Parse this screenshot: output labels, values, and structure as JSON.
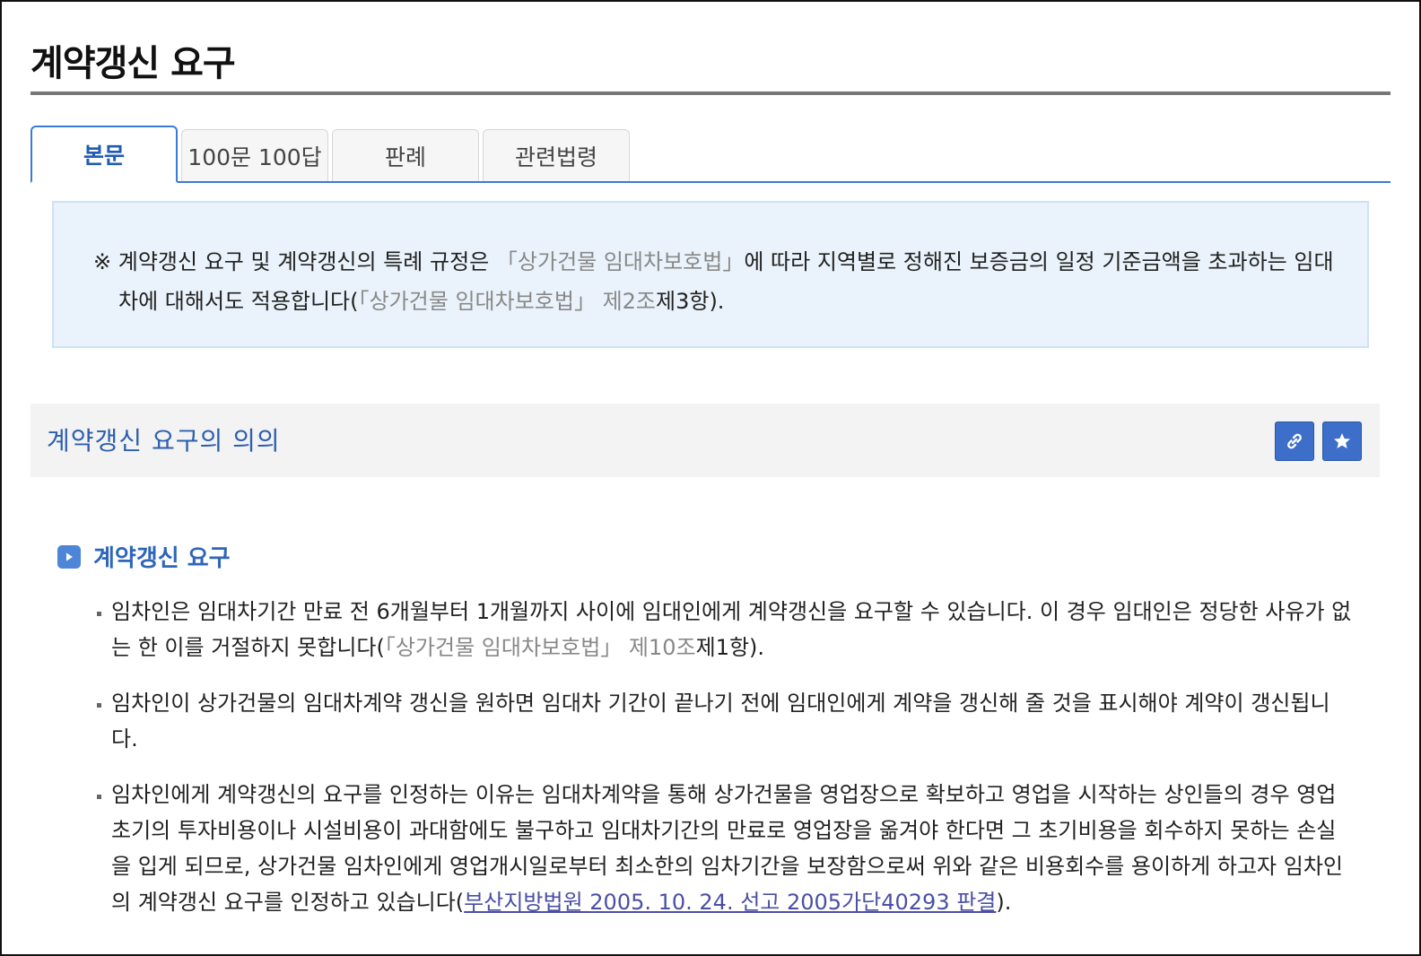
{
  "page": {
    "title": "계약갱신 요구"
  },
  "tabs": [
    {
      "label": "본문",
      "active": true
    },
    {
      "label": "100문 100답",
      "active": false
    },
    {
      "label": "판례",
      "active": false
    },
    {
      "label": "관련법령",
      "active": false
    }
  ],
  "notice": {
    "mark": "※",
    "text_a": "계약갱신 요구 및 계약갱신의 특례 규정은",
    "law_ref_a": "「상가건물 임대차보호법」",
    "text_b": "에 따라 지역별로 정해진 보증금의 일정 기준금액을 초과하는 임대차에 대해서도 적용합니다(",
    "law_ref_b": "「상가건물 임대차보호법」 제2조",
    "text_c": "제3항)."
  },
  "section": {
    "title": "계약갱신 요구의 의의",
    "link_icon": "link-icon",
    "star_icon": "star-icon"
  },
  "subsection": {
    "title": "계약갱신 요구",
    "icon": "play-arrow-icon"
  },
  "paragraphs": {
    "p1_a": "임차인은 임대차기간 만료 전 6개월부터 1개월까지 사이에 임대인에게 계약갱신을 요구할 수 있습니다. 이 경우 임대인은 정당한 사유가 없는 한 이를 거절하지 못합니다(",
    "p1_ref": "「상가건물 임대차보호법」 제10조",
    "p1_b": "제1항).",
    "p2": "임차인이 상가건물의 임대차계약 갱신을 원하면 임대차 기간이 끝나기 전에 임대인에게 계약을 갱신해 줄 것을 표시해야 계약이 갱신됩니다.",
    "p3_a": "임차인에게 계약갱신의 요구를 인정하는 이유는 임대차계약을 통해 상가건물을 영업장으로 확보하고 영업을 시작하는 상인들의 경우 영업초기의 투자비용이나 시설비용이 과대함에도 불구하고 임대차기간의 만료로 영업장을 옮겨야 한다면 그 초기비용을 회수하지 못하는 손실을 입게 되므로, 상가건물 임차인에게 영업개시일로부터 최소한의 임차기간을 보장함으로써 위와 같은 비용회수를 용이하게 하고자 임차인의 계약갱신 요구를 인정하고 있습니다(",
    "p3_link": "부산지방법원 2005. 10. 24. 선고 2005가단40293 판결",
    "p3_b": ")."
  }
}
